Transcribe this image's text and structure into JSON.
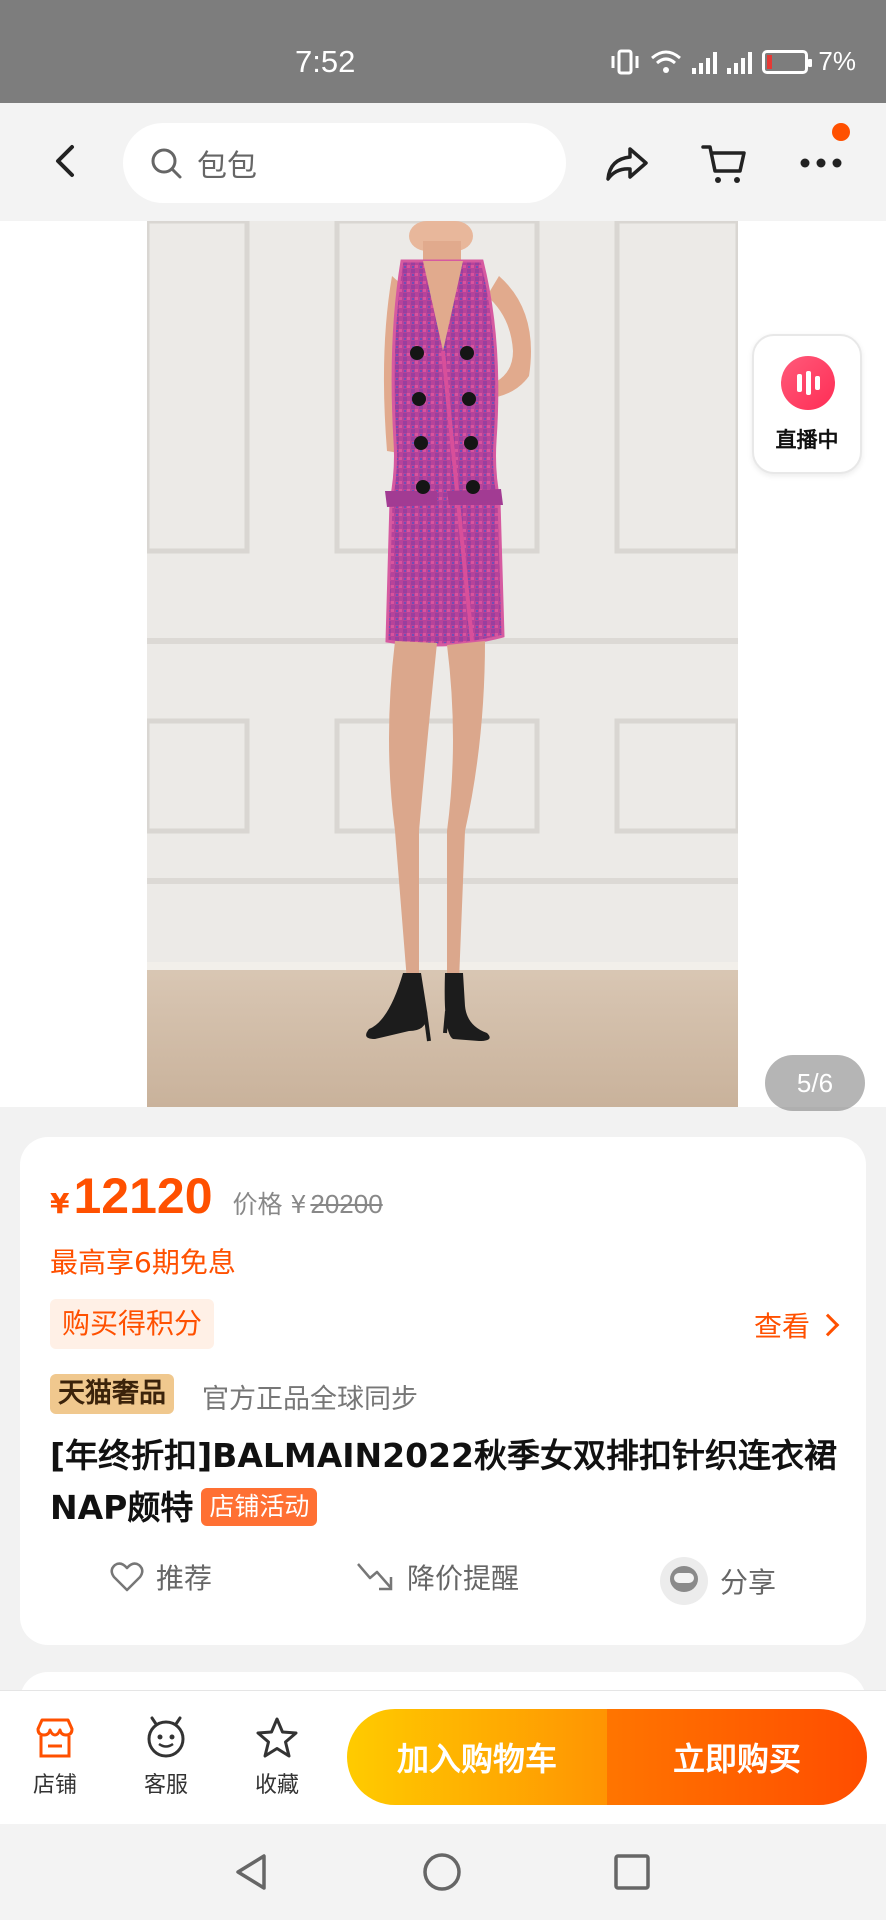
{
  "status_bar": {
    "time": "7:52",
    "network": "4G",
    "battery": "7%"
  },
  "nav": {
    "search_placeholder": "包包",
    "icons": [
      "back-icon",
      "share-icon",
      "cart-icon",
      "more-icon"
    ]
  },
  "gallery": {
    "live_label": "直播中",
    "page_counter": "5/6",
    "current_page": 5,
    "total_pages": 6
  },
  "price": {
    "currency": "¥",
    "value": "12120",
    "original_label": "价格 ¥",
    "original_value": "20200"
  },
  "promo": {
    "installment": "最高享6期免息",
    "points": "购买得积分",
    "view": "查看"
  },
  "brand": {
    "tag": "天猫奢品",
    "subtitle": "官方正品全球同步"
  },
  "product": {
    "title": "[年终折扣]BALMAIN2022秋季女双排扣针织连衣裙NAP颇特",
    "activity_tag": "店铺活动"
  },
  "actions": {
    "recommend": "推荐",
    "price_alert": "降价提醒",
    "share": "分享"
  },
  "bottom_bar": {
    "shop": "店铺",
    "service": "客服",
    "favorite": "收藏",
    "add_to_cart": "加入购物车",
    "buy_now": "立即购买"
  },
  "colors": {
    "accent": "#ff5000",
    "cart_button": "#ffb400",
    "buy_button": "#ff5a00",
    "dress": "#b6439a"
  }
}
